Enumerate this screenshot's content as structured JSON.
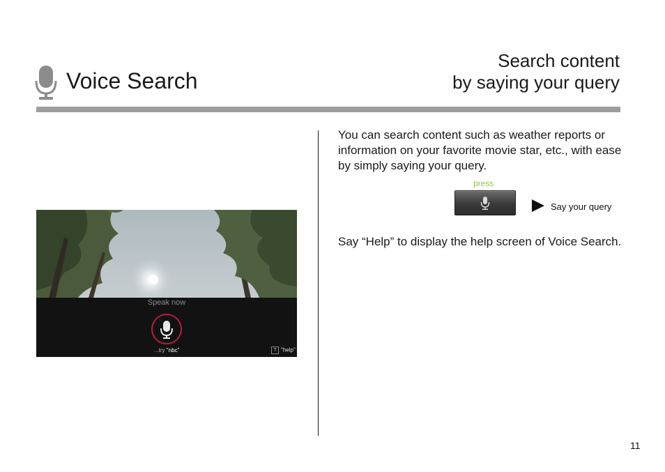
{
  "header": {
    "title": "Voice Search",
    "subtitle_line1": "Search content",
    "subtitle_line2": "by saying your query",
    "icon": "microphone-icon"
  },
  "screenshot": {
    "speak_now": "Speak now",
    "try_prefix": "...try",
    "try_word": "\"nbc\"",
    "help_word": "\"help\"",
    "help_symbol": "?"
  },
  "content": {
    "intro": "You can search content such as weather reports or information on your favorite movie star, etc., with ease by simply saying your query.",
    "press_label": "press",
    "step_label": "Say your query",
    "help_paragraph": "Say “Help” to display the help screen of Voice Search."
  },
  "page_number": "11",
  "colors": {
    "rule": "#9e9e9e",
    "press": "#8dc63f",
    "mic_ring": "#b3203a"
  }
}
